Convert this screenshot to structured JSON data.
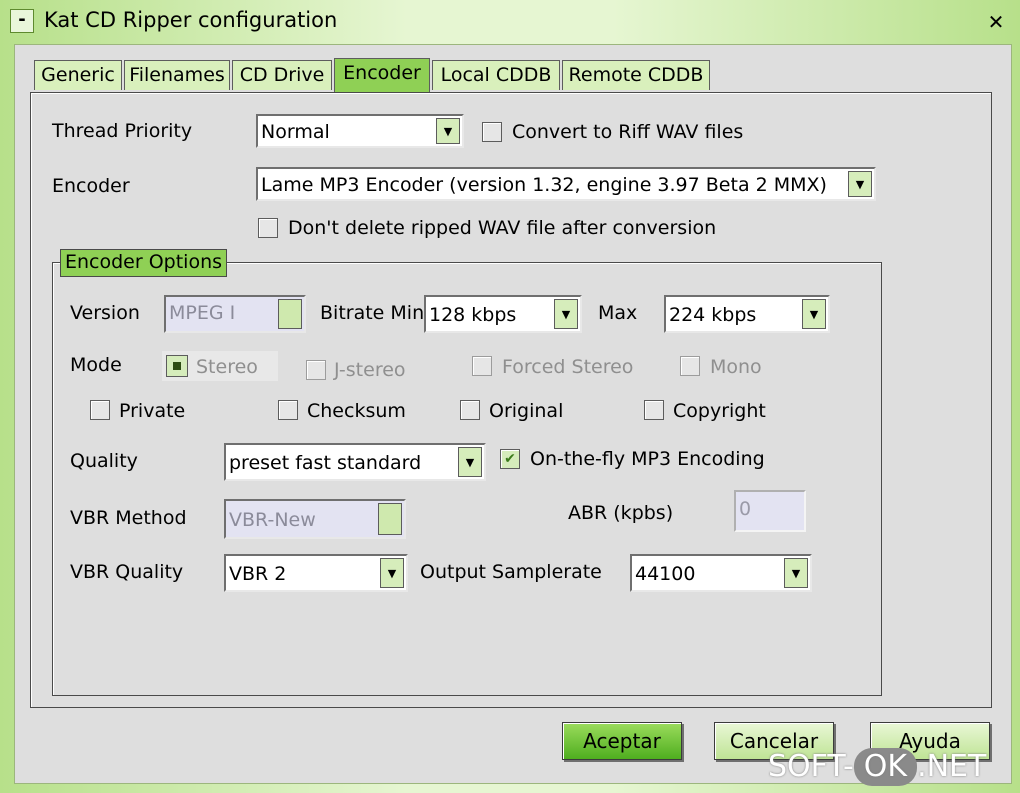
{
  "window": {
    "title": "Kat CD Ripper configuration",
    "sysmenu": "-",
    "close": "✕"
  },
  "tabs": [
    "Generic",
    "Filenames",
    "CD Drive",
    "Encoder",
    "Local CDDB",
    "Remote CDDB"
  ],
  "active_tab": "Encoder",
  "encoder": {
    "thread_priority_label": "Thread Priority",
    "thread_priority_value": "Normal",
    "convert_riff_label": "Convert to Riff WAV files",
    "encoder_label": "Encoder",
    "encoder_value": "Lame MP3 Encoder (version 1.32, engine 3.97 Beta 2 MMX)",
    "dont_delete_label": "Don't delete ripped WAV file after conversion"
  },
  "options": {
    "group_label": "Encoder Options",
    "version_label": "Version",
    "version_value": "MPEG I",
    "bitrate_min_label": "Bitrate Min",
    "bitrate_min_value": "128 kbps",
    "max_label": "Max",
    "max_value": "224 kbps",
    "mode_label": "Mode",
    "mode_stereo": "Stereo",
    "mode_jstereo": "J-stereo",
    "mode_forced": "Forced Stereo",
    "mode_mono": "Mono",
    "private_label": "Private",
    "checksum_label": "Checksum",
    "original_label": "Original",
    "copyright_label": "Copyright",
    "quality_label": "Quality",
    "quality_value": "preset fast standard",
    "onthefly_label": "On-the-fly MP3 Encoding",
    "vbr_method_label": "VBR Method",
    "vbr_method_value": "VBR-New",
    "abr_label": "ABR (kpbs)",
    "abr_value": "0",
    "vbr_quality_label": "VBR Quality",
    "vbr_quality_value": "VBR 2",
    "samplerate_label": "Output Samplerate",
    "samplerate_value": "44100"
  },
  "buttons": {
    "ok": "Aceptar",
    "cancel": "Cancelar",
    "help": "Ayuda"
  },
  "watermark": {
    "left": "SOFT-",
    "pill": "OK",
    "right": ".NET"
  },
  "colors": {
    "accent_green": "#8fd055",
    "default_button": "#4fae1f",
    "frame": "#b7e08a"
  }
}
